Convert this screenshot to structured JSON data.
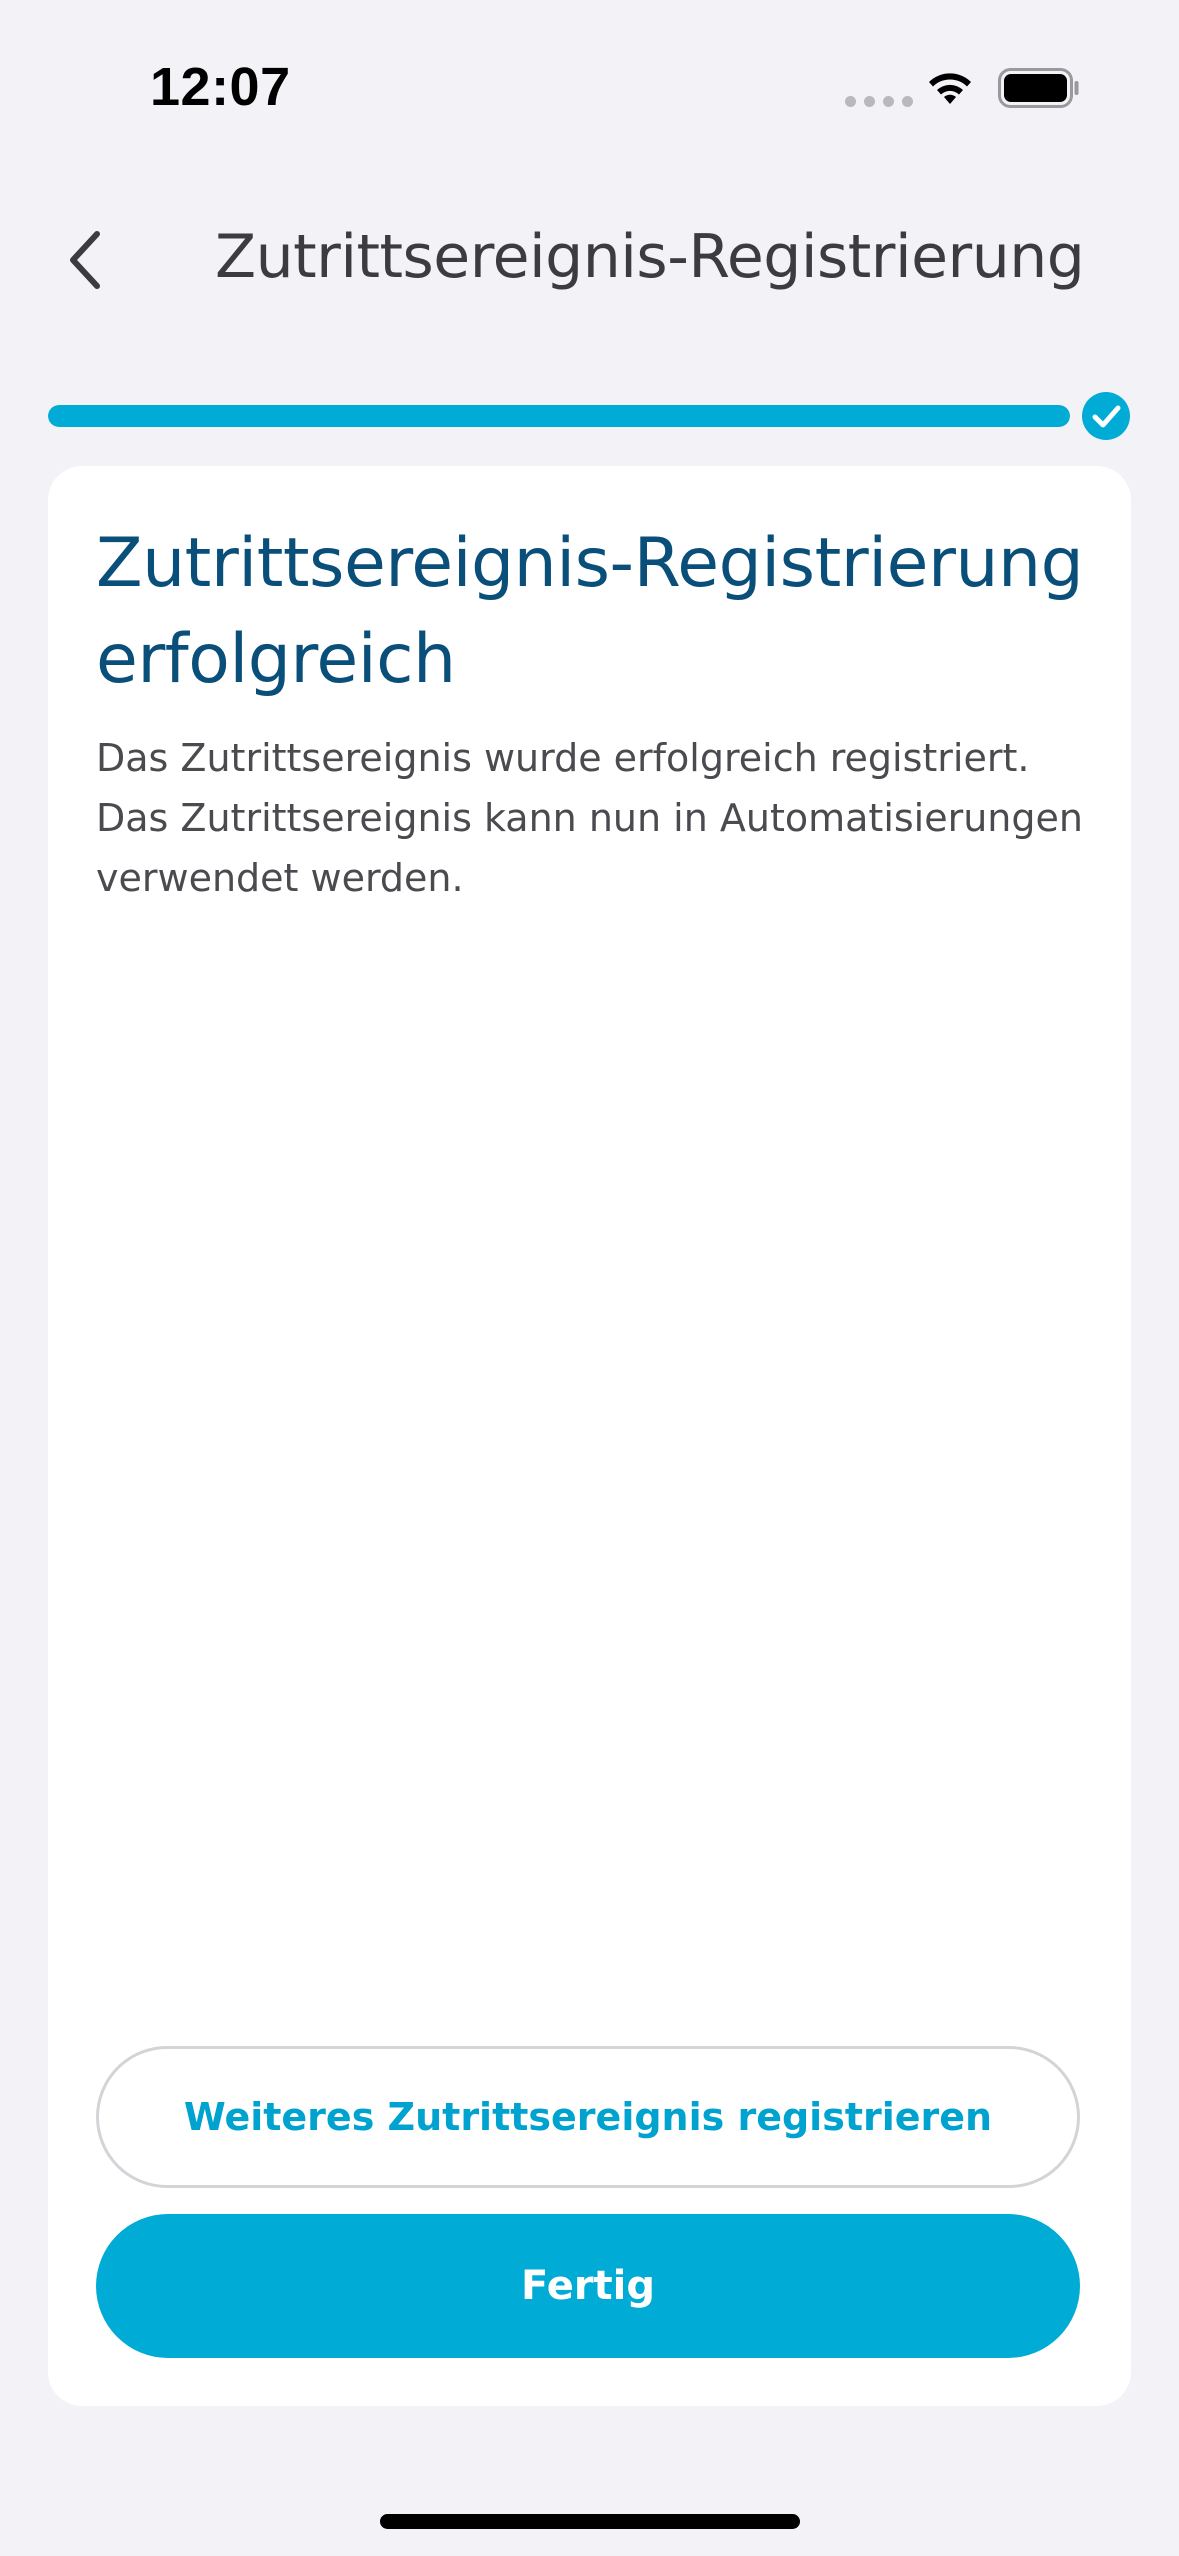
{
  "status_bar": {
    "time": "12:07"
  },
  "nav": {
    "title": "Zutrittsereignis-Registrierung",
    "back_icon": "chevron-left-icon"
  },
  "progress": {
    "value_percent": 100,
    "complete_icon": "check-circle-icon"
  },
  "card": {
    "title": "Zutrittsereignis-Registrierung erfolgreich",
    "body": "Das Zutrittsereignis wurde erfolgreich registriert. Das Zutrittsereignis kann nun in Automatisierungen verwendet werden."
  },
  "actions": {
    "register_another_label": "Weiteres Zutrittsereignis registrieren",
    "done_label": "Fertig"
  },
  "colors": {
    "accent": "#00abd6",
    "title": "#0a4f7a",
    "background": "#f2f2f7"
  }
}
